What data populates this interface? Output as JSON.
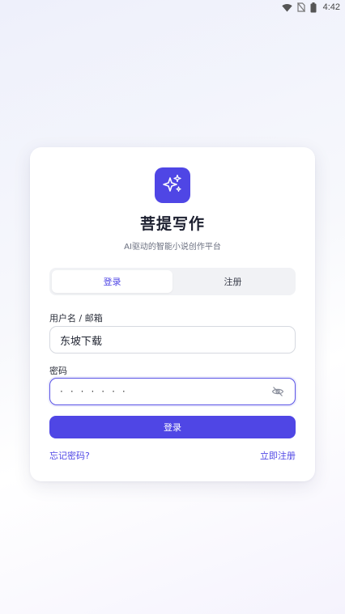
{
  "status_bar": {
    "time": "4:42",
    "icons": [
      "wifi-icon",
      "no-sim-icon",
      "battery-icon"
    ]
  },
  "app": {
    "logo_icon": "sparkles-icon",
    "title": "菩提写作",
    "subtitle": "AI驱动的智能小说创作平台"
  },
  "tabs": [
    {
      "label": "登录",
      "active": true
    },
    {
      "label": "注册",
      "active": false
    }
  ],
  "form": {
    "username_label": "用户名 / 邮箱",
    "username_value": "东坡下载",
    "password_label": "密码",
    "password_masked": "·······",
    "password_toggle_icon": "eye-off-icon",
    "submit_label": "登录"
  },
  "links": {
    "forgot": "忘记密码?",
    "register": "立即注册"
  },
  "colors": {
    "primary": "#4f46e5",
    "card_bg": "#ffffff",
    "tab_bg": "#f1f2f5"
  }
}
